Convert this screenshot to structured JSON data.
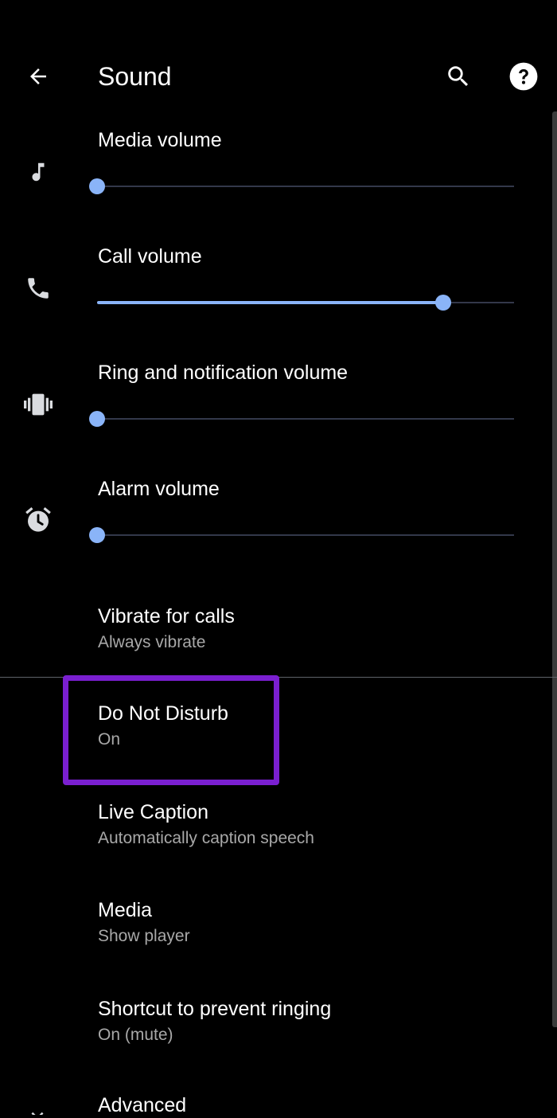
{
  "appbar": {
    "title": "Sound",
    "back_icon": "arrow-left-icon",
    "search_icon": "search-icon",
    "help_icon": "help-icon"
  },
  "volumes": [
    {
      "label": "Media volume",
      "icon": "music-note-icon",
      "level": 0.0
    },
    {
      "label": "Call volume",
      "icon": "phone-icon",
      "level": 0.83
    },
    {
      "label": "Ring and notification volume",
      "icon": "vibrate-icon",
      "level": 0.0
    },
    {
      "label": "Alarm volume",
      "icon": "alarm-clock-icon",
      "level": 0.0
    }
  ],
  "prefs": [
    {
      "title": "Vibrate for calls",
      "subtitle": "Always vibrate"
    },
    {
      "title": "Do Not Disturb",
      "subtitle": "On"
    },
    {
      "title": "Live Caption",
      "subtitle": "Automatically caption speech"
    },
    {
      "title": "Media",
      "subtitle": "Show player"
    },
    {
      "title": "Shortcut to prevent ringing",
      "subtitle": "On (mute)"
    },
    {
      "title": "Advanced",
      "icon": "chevron-down-icon"
    }
  ],
  "colors": {
    "background": "#000000",
    "accent": "#8ab4f8",
    "highlight": "#7a1fd0",
    "secondary_text": "#a8a8a8"
  }
}
